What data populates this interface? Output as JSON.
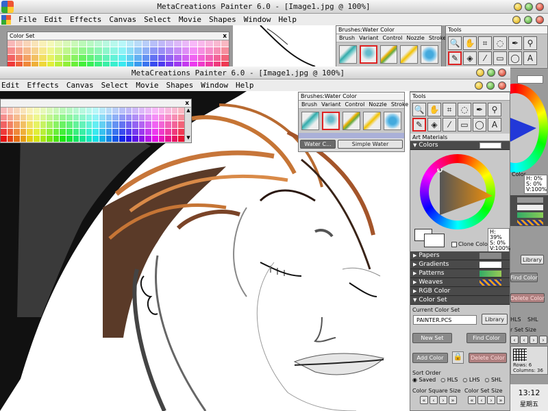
{
  "app": {
    "title": "MetaCreations Painter 6.0 - [Image1.jpg @ 100%]",
    "back_title": "MetaCreations Painter 6.0 - [Image1.jpg @ 100%]"
  },
  "menu_back": [
    "File",
    "Edit",
    "Effects",
    "Canvas",
    "Select",
    "Movie",
    "Shapes",
    "Window",
    "Help"
  ],
  "menu": [
    "Edit",
    "Effects",
    "Canvas",
    "Select",
    "Movie",
    "Shapes",
    "Window",
    "Help"
  ],
  "color_set_panel": {
    "title": "Color Set",
    "close": "x"
  },
  "brushes_panel": {
    "title": "Brushes:Water Color",
    "tabs": [
      "Brush",
      "Variant",
      "Control",
      "Nozzle",
      "Stroke"
    ],
    "category": "Water C...",
    "variant": "Simple Water"
  },
  "tools_panel": {
    "title": "Tools",
    "tools": [
      "magnifier-icon",
      "grabber-icon",
      "crop-icon",
      "lasso-icon",
      "pen-icon",
      "selector-icon",
      "brush-icon",
      "paint-bucket-icon",
      "dropper-icon",
      "rectangle-select-icon",
      "oval-shape-icon",
      "text-icon"
    ],
    "tool_glyphs": [
      "🔍",
      "✋",
      "⌗",
      "◌",
      "✒",
      "⚲",
      "✎",
      "◈",
      "⁄",
      "▭",
      "◯",
      "A"
    ]
  },
  "art_materials": {
    "title": "Art Materials",
    "colors_label": "Colors",
    "hsv": {
      "h": "H: 39%",
      "s": "S:  0%",
      "v": "V:100%"
    },
    "clone_color": "Clone Color",
    "sections": [
      "Papers",
      "Gradients",
      "Patterns",
      "Weaves",
      "RGB Color"
    ],
    "color_set_label": "Color Set",
    "current_color_set_label": "Current Color Set",
    "current_color_set_value": "PAINTER.PCS",
    "library_btn": "Library",
    "new_set_btn": "New Set",
    "find_color_btn": "Find Color",
    "add_color_btn": "Add Color",
    "delete_color_btn": "Delete Color",
    "sort_order_label": "Sort Order",
    "sort_options": [
      "Saved",
      "HLS",
      "LHS",
      "SHL"
    ],
    "color_square_size_label": "Color Square Size",
    "color_set_size_label": "Color Set Size"
  },
  "back_panel": {
    "hsv": {
      "h": "H:  0%",
      "s": "S:  0%",
      "v": "V:100%"
    },
    "color_label": "Color",
    "library": "Library",
    "find_color": "Find Color",
    "delete_color": "Delete Color",
    "hls": "HLS",
    "shl": "SHL",
    "set_size": "r Set Size",
    "rows": "Rows: 6",
    "columns": "Columns: 36"
  },
  "clock": {
    "time": "13:12",
    "day": "星期五"
  },
  "colors": {
    "accent_red": "#d22222",
    "section_dark": "#4a4a4a",
    "canvas_gray": "#8a8a8a"
  }
}
